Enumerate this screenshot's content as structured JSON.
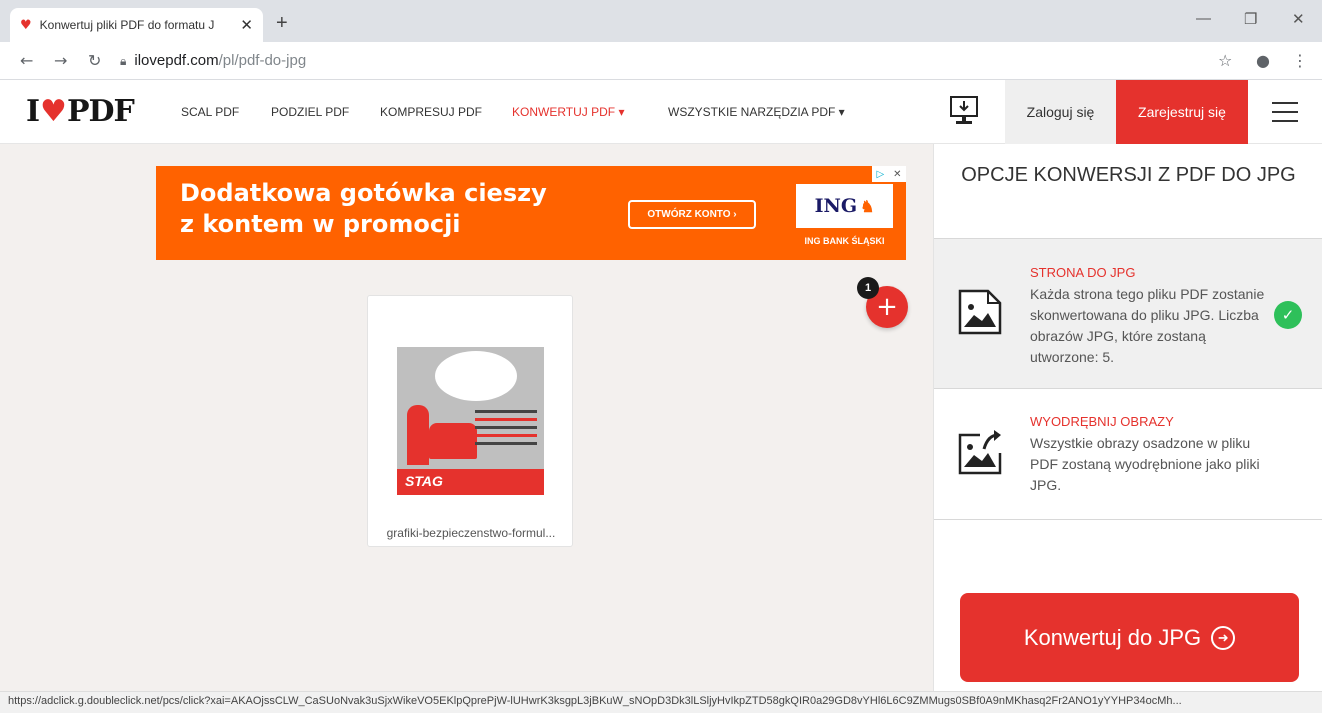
{
  "browser": {
    "tab_title": "Konwertuj pliki PDF do formatu J",
    "url_domain": "ilovepdf.com",
    "url_path": "/pl/pdf-do-jpg",
    "new_tab": "+"
  },
  "header": {
    "logo_left": "I",
    "logo_right": "PDF",
    "nav": [
      "SCAL PDF",
      "PODZIEL PDF",
      "KOMPRESUJ PDF",
      "KONWERTUJ PDF ▾",
      "WSZYSTKIE NARZĘDZIA PDF ▾"
    ],
    "login": "Zaloguj się",
    "register": "Zarejestruj się"
  },
  "ad": {
    "headline_line1": "Dodatkowa gotówka cieszy",
    "headline_line2": "z kontem w promocji",
    "button": "OTWÓRZ KONTO  ›",
    "bank_logo": "ING",
    "bank_name": "ING BANK ŚLĄSKI"
  },
  "file": {
    "count_badge": "1",
    "name": "grafiki-bezpieczenstwo-formul...",
    "thumb_brand": "STAG"
  },
  "sidebar": {
    "title": "OPCJE KONWERSJI Z PDF DO JPG",
    "options": [
      {
        "title": "STRONA DO JPG",
        "description": "Każda strona tego pliku PDF zostanie skonwertowana do pliku JPG. Liczba obrazów JPG, które zostaną utworzone: 5.",
        "selected": true
      },
      {
        "title": "WYODRĘBNIJ OBRAZY",
        "description": "Wszystkie obrazy osadzone w pliku PDF zostaną wyodrębnione jako pliki JPG.",
        "selected": false
      }
    ],
    "convert_button": "Konwertuj do JPG"
  },
  "statusbar": {
    "url": "https://adclick.g.doubleclick.net/pcs/click?xai=AKAOjssCLW_CaSUoNvak3uSjxWikeVO5EKlpQprePjW-lUHwrK3ksgpL3jBKuW_sNOpD3Dk3lLSljyHvIkpZTD58gkQIR0a29GD8vYHl6L6C9ZMMugs0SBf0A9nMKhasq2Fr2ANO1yYYHP34ocMh..."
  },
  "colors": {
    "brand_red": "#e5322d",
    "ad_orange": "#ff6200",
    "success_green": "#2ec05a"
  }
}
